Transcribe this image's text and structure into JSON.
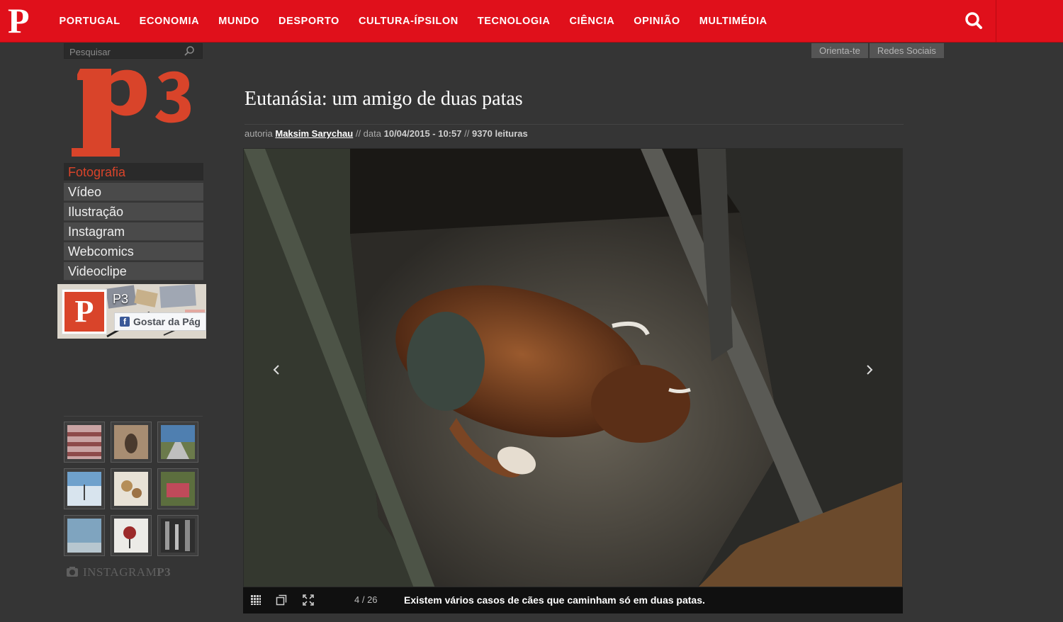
{
  "header": {
    "logo_letter": "P",
    "nav": [
      "PORTUGAL",
      "ECONOMIA",
      "MUNDO",
      "DESPORTO",
      "CULTURA-ÍPSILON",
      "TECNOLOGIA",
      "CIÊNCIA",
      "OPINIÃO",
      "MULTIMÉDIA"
    ],
    "search_icon": "search-icon",
    "accent_color": "#e0101b"
  },
  "sidebar": {
    "search_placeholder": "Pesquisar",
    "logo_text": "P3",
    "menu": [
      "Fotografia",
      "Vídeo",
      "Ilustração",
      "Instagram",
      "Webcomics",
      "Videoclipe"
    ],
    "active_menu": "Fotografia",
    "facebook": {
      "page_name": "P3",
      "like_label": "Gostar da Pág"
    },
    "instagram_label": "INSTAGRAM",
    "instagram_label_bold": "P3"
  },
  "top_tabs": [
    "Orienta-te",
    "Redes Sociais"
  ],
  "article": {
    "title": "Eutanásia: um amigo de duas patas",
    "meta_author_prefix": "autoria",
    "author": "Maksim Sarychau",
    "meta_date_prefix": "// data",
    "date": "10/04/2015 - 10:57",
    "meta_views_sep": "//",
    "views": "9370 leituras"
  },
  "gallery": {
    "counter": "4 / 26",
    "caption": "Existem vários casos de cães que caminham só em duas patas.",
    "prev_icon": "chevron-left-icon",
    "next_icon": "chevron-right-icon"
  }
}
